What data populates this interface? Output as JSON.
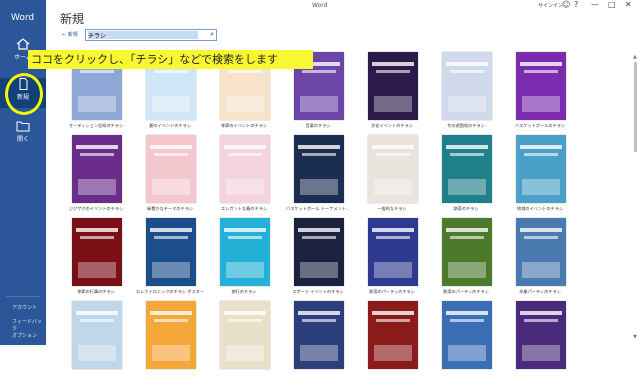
{
  "app": {
    "title": "Word",
    "window_title": "Word",
    "signin": "サインイン",
    "window_controls": [
      "—",
      "□",
      "✕"
    ]
  },
  "nav": {
    "home": "ホーム",
    "new": "新規",
    "open": "開く",
    "bottom": [
      "アカウント",
      "フィードバック",
      "オプション"
    ]
  },
  "page": {
    "title": "新規",
    "back_label": "← 新規",
    "search_value": "チラシ"
  },
  "annotation": "ココをクリックし、「チラシ」などで検索をします",
  "templates": [
    {
      "caption": "オーディション告知のチラシ",
      "color": "#8ea7d6"
    },
    {
      "caption": "夏のイベントのチラシ",
      "color": "#cfe6f7"
    },
    {
      "caption": "季節のイベントのチラシ",
      "color": "#f6e3c9"
    },
    {
      "caption": "音楽のチラシ",
      "color": "#6b46a8"
    },
    {
      "caption": "文化イベントのチラシ",
      "color": "#2c1a4a"
    },
    {
      "caption": "冬の遊園地のチラシ",
      "color": "#cfd9ea"
    },
    {
      "caption": "バスケットボールのチラシ",
      "color": "#7b2bb0"
    },
    {
      "caption": "ジグザグのイベントのチラシ",
      "color": "#6a2d8a"
    },
    {
      "caption": "緑豊かなテーマのチラシ",
      "color": "#f4c7cf"
    },
    {
      "caption": "エレガントな春のチラシ",
      "color": "#f3d3de"
    },
    {
      "caption": "バスケットボール トーナメント...",
      "color": "#1c2d52"
    },
    {
      "caption": "一般的なチラシ",
      "color": "#e9e4dc"
    },
    {
      "caption": "熱帯のチラシ",
      "color": "#1f7f8a"
    },
    {
      "caption": "地域のイベントのチラシ",
      "color": "#4aa0c8"
    },
    {
      "caption": "季節の行事のチラシ",
      "color": "#7a0f16"
    },
    {
      "caption": "エレクトロニックのチラシ ポスター",
      "color": "#1d4e8c"
    },
    {
      "caption": "旅行のチラシ",
      "color": "#23b1d8"
    },
    {
      "caption": "スポーツ イベントのチラシ",
      "color": "#1a2240"
    },
    {
      "caption": "熱帯のパーティのチラシ",
      "color": "#2e3a8f"
    },
    {
      "caption": "熱帯のパーティのチラシ",
      "color": "#4a7a2a"
    },
    {
      "caption": "卒業パーティのチラシ",
      "color": "#4a7ab0"
    },
    {
      "caption": "",
      "color": "#c0d6e9"
    },
    {
      "caption": "",
      "color": "#f6a73a"
    },
    {
      "caption": "",
      "color": "#e9e0c9"
    },
    {
      "caption": "",
      "color": "#2d3f7a"
    },
    {
      "caption": "",
      "color": "#8b1b1b"
    },
    {
      "caption": "",
      "color": "#3b6fb5"
    },
    {
      "caption": "",
      "color": "#4a2a7a"
    }
  ],
  "colors": {
    "sidebar": "#2b579a",
    "annotation_bg": "#f7f82f",
    "highlight_ring": "#f5f900"
  }
}
